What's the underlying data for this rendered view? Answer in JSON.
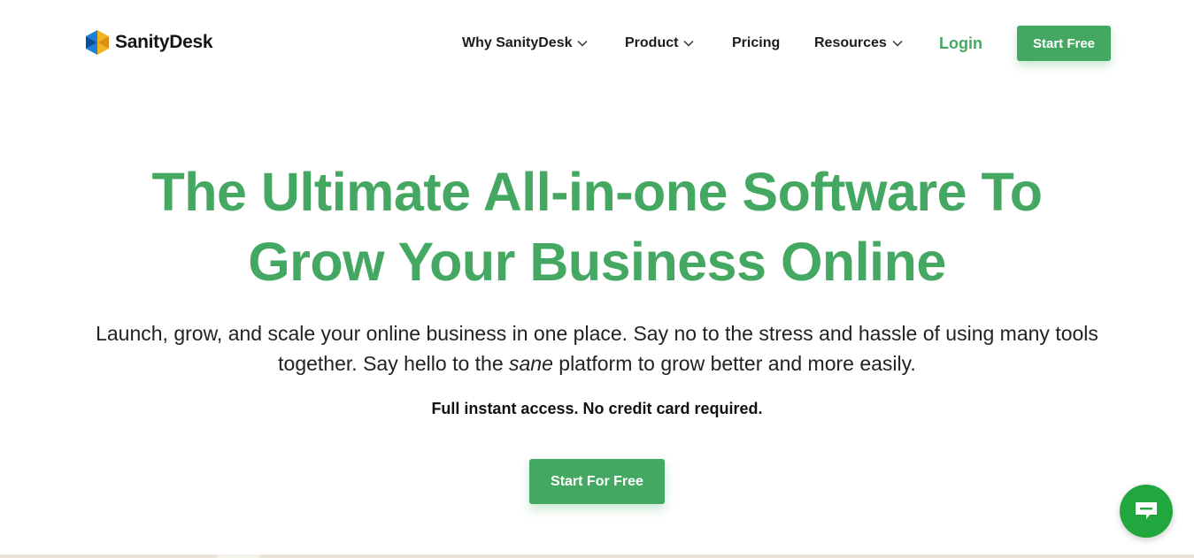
{
  "brand": {
    "name": "SanityDesk",
    "accent": "#45a862",
    "chat_color": "#22a73f"
  },
  "nav": {
    "items": [
      {
        "label": "Why SanityDesk",
        "has_dropdown": true
      },
      {
        "label": "Product",
        "has_dropdown": true
      },
      {
        "label": "Pricing",
        "has_dropdown": false
      },
      {
        "label": "Resources",
        "has_dropdown": true
      }
    ],
    "login_label": "Login",
    "cta_label": "Start Free"
  },
  "hero": {
    "title_line1": "The Ultimate All-in-one Software To",
    "title_line2": "Grow Your Business Online",
    "subtitle_part1": "Launch, grow, and scale your online business in one place. Say no to the stress and hassle of using many tools together. Say hello to the ",
    "subtitle_emphasis": "sane",
    "subtitle_part2": " platform to grow better and more easily.",
    "note": "Full instant access. No credit card required.",
    "cta_label": "Start For Free"
  },
  "icons": {
    "logo": "sanitydesk-logo-icon",
    "chevron": "chevron-down-icon",
    "chat": "chat-bubble-icon"
  }
}
